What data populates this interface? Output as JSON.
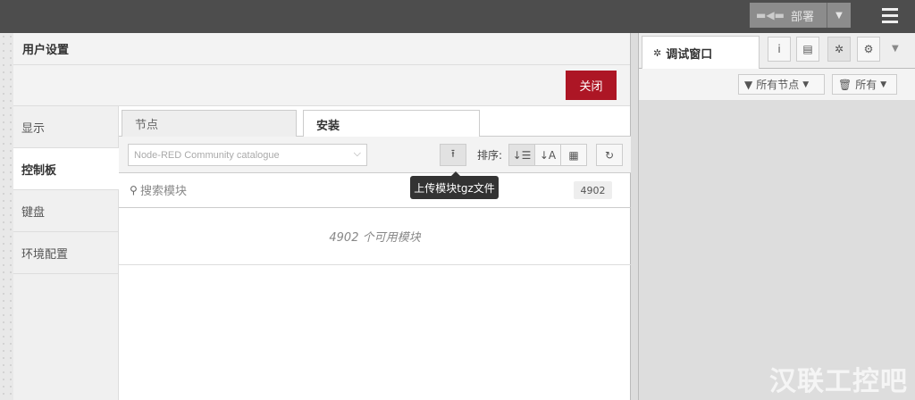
{
  "header": {
    "deploy_label": "部署"
  },
  "dialog": {
    "title": "用户设置",
    "close_label": "关闭",
    "side_tabs": [
      "显示",
      "控制板",
      "键盘",
      "环境配置"
    ],
    "tabs": [
      "节点",
      "安装"
    ],
    "catalog_select": "Node-RED Community catalogue",
    "sort_label": "排序:",
    "search_placeholder": "搜索模块",
    "module_count": "4902",
    "result_text": "4902 个可用模块",
    "tooltip": "上传模块tgz文件"
  },
  "sidebar": {
    "debug_tab": "调试窗口",
    "filter_nodes": "所有节点",
    "filter_all": "所有"
  },
  "watermark": "汉联工控吧",
  "icons": [
    "deploy-icon",
    "menu-icon",
    "upload-icon",
    "sort-alpha-icon",
    "sort-date-icon",
    "calendar-icon",
    "refresh-icon",
    "search-icon",
    "bug-icon",
    "info-icon",
    "book-icon",
    "gear-icon",
    "filter-icon",
    "trash-icon"
  ]
}
